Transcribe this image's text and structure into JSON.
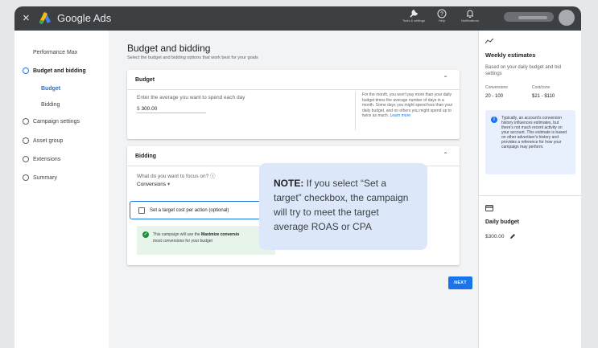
{
  "app": {
    "brand": "Google Ads",
    "close_label": "×"
  },
  "topbar": {
    "tools": [
      {
        "name": "tools-and-settings",
        "label": "Tools & settings",
        "icon": "wrench-icon"
      },
      {
        "name": "help",
        "label": "Help",
        "icon": "help-icon"
      },
      {
        "name": "notifications",
        "label": "Notifications",
        "icon": "bell-icon"
      }
    ]
  },
  "sidebar": {
    "campaign_type": "Performance Max",
    "items": [
      {
        "label": "Budget and bidding",
        "active": true
      },
      {
        "label": "Budget",
        "sub": true,
        "selected": true
      },
      {
        "label": "Bidding",
        "sub": true
      },
      {
        "label": "Campaign settings"
      },
      {
        "label": "Asset group"
      },
      {
        "label": "Extensions"
      },
      {
        "label": "Summary"
      }
    ]
  },
  "main": {
    "title": "Budget and bidding",
    "subtitle": "Select the budget and bidding options that work best for your goals",
    "budget_card": {
      "heading": "Budget",
      "prompt": "Enter the average you want to spend each day",
      "currency": "$",
      "amount": "300.00",
      "help_text": "For the month, you won't pay more than your daily budget times the average number of days in a month. Some days you might spend less than your daily budget, and on others you might spend up to twice as much.",
      "learn_more": "Learn more"
    },
    "bidding_card": {
      "heading": "Bidding",
      "focus_question": "What do you want to focus on?",
      "focus_value": "Conversions",
      "checkbox_label": "Set a target cost per action (optional)",
      "note_prefix": "This campaign will use the ",
      "note_bold": "Maximize conversio",
      "note_line2": "most conversions for your budget"
    },
    "next_label": "NEXT"
  },
  "callout": {
    "bold": "NOTE:",
    "text": " If you select “Set a target” checkbox, the campaign will try to meet the target average ROAS or CPA"
  },
  "right_panel": {
    "title": "Weekly estimates",
    "subtitle": "Based on your daily budget and bid settings",
    "col1_head": "Conversions",
    "col1_val": "20 - 100",
    "col2_head": "Cost/conv",
    "col2_val": "$21 - $110",
    "info_text": "Typically, an account's conversion history influences estimates, but there's not much recent activity on your account. This estimate is based on other advertiser's history and provides a reference for how your campaign may perform.",
    "daily_budget_title": "Daily budget",
    "daily_budget_value": "$300.00"
  },
  "colors": {
    "accent": "#1a73e8",
    "topbar": "#3c4043",
    "callout_bg": "#dce7f9",
    "success": "#1e8e3e"
  }
}
